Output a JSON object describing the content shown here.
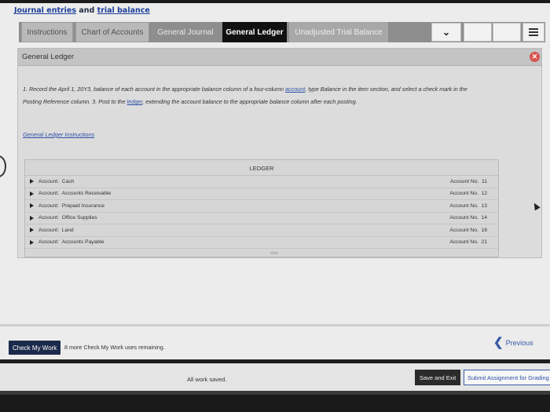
{
  "page_title": {
    "part1": "Journal entries",
    "part2": "and",
    "part3": "trial balance"
  },
  "tabs": [
    {
      "label": "Instructions"
    },
    {
      "label": "Chart of Accounts"
    },
    {
      "label": "General Journal"
    },
    {
      "label": "General Ledger"
    },
    {
      "label": "Unadjusted Trial Balance"
    }
  ],
  "panel": {
    "header": "General Ledger",
    "instructions": {
      "line1_a": "1. Record the April 1, 20Y3, balance of each account in the appropriate balance column of a four-column ",
      "line1_link": "account",
      "line1_b": ", type Balance in the item section, and select a check mark in the",
      "line2_a": "Posting Reference column. 3. Post to the ",
      "line2_link": "ledger",
      "line2_b": ", extending the account balance to the appropriate balance column after each posting."
    },
    "gl_instructions_link": "General Ledger Instructions"
  },
  "ledger": {
    "title": "LEDGER",
    "accounts": [
      {
        "label": "Account:",
        "name": "Cash",
        "no_label": "Account No.",
        "no": "11"
      },
      {
        "label": "Account:",
        "name": "Accounts Receivable",
        "no_label": "Account No.",
        "no": "12"
      },
      {
        "label": "Account:",
        "name": "Prepaid Insurance",
        "no_label": "Account No.",
        "no": "13"
      },
      {
        "label": "Account:",
        "name": "Office Supplies",
        "no_label": "Account No.",
        "no": "14"
      },
      {
        "label": "Account:",
        "name": "Land",
        "no_label": "Account No.",
        "no": "16"
      },
      {
        "label": "Account:",
        "name": "Accounts Payable",
        "no_label": "Account No.",
        "no": "21"
      }
    ]
  },
  "footer": {
    "check_button": "Check My Work",
    "check_text": "8 more Check My Work uses remaining.",
    "previous": "Previous",
    "saved": "All work saved.",
    "save_exit": "Save and Exit",
    "submit": "Submit Assignment for Grading"
  }
}
